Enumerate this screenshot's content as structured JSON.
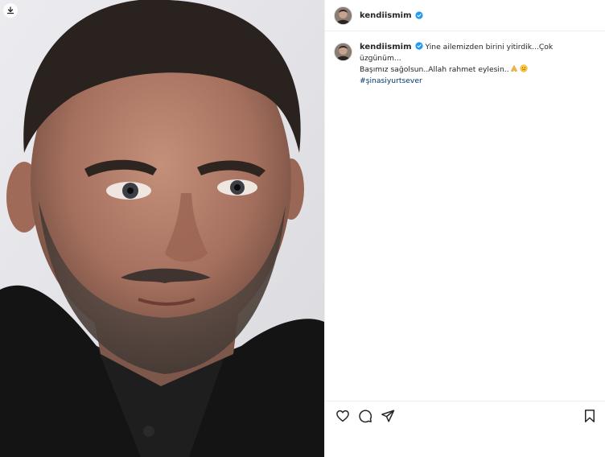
{
  "post": {
    "author": {
      "username": "kendiismim",
      "verified": true
    },
    "caption": {
      "username": "kendiismim",
      "text_line1": " Yine ailemizden birini yitirdik...Çok üzgünüm...",
      "text_line2": "Başımız sağolsun..Allah rahmet eylesin..",
      "hashtag": "#şinasiyurtsever"
    },
    "image": {
      "description_icon": "portrait-photo",
      "download_icon": "download-icon"
    },
    "actions": {
      "like": "heart-icon",
      "comment": "comment-icon",
      "share": "share-icon",
      "save": "bookmark-icon"
    },
    "colors": {
      "verified": "#1d9bf0",
      "hashtag": "#00376b",
      "text": "#262626",
      "divider": "#efefef"
    }
  }
}
